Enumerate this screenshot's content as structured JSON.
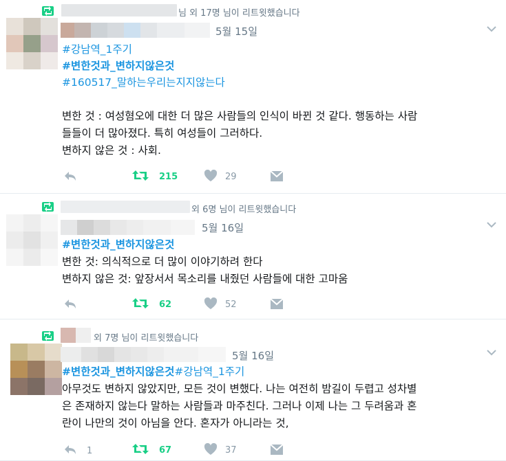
{
  "tweets": [
    {
      "retweeted_by": "님 외 17명 님이 리트윗했습니다",
      "date": "5월 15일",
      "hashtags": [
        "#강남역_1주기",
        "#변한것과_변하지않은것",
        "#160517_말하는우리는지지않는다"
      ],
      "body": [
        "변한 것 : 여성혐오에 대한 더 많은 사람들의 인식이 바뀐 것 같다. 행동하는 사람",
        "들들이 더 많아졌다. 특히 여성들이 그러하다.",
        "변하지 않은 것 : 사회."
      ],
      "retweets": "215",
      "likes": "29",
      "replies": ""
    },
    {
      "retweeted_by": "외 6명 님이 리트윗했습니다",
      "date": "5월 16일",
      "hashtags": [
        "#변한것과_변하지않은것"
      ],
      "body": [
        "변한 것: 의식적으로 더 많이 이야기하려 한다",
        "변하지 않은 것: 앞장서서 목소리를 내줬던 사람들에 대한 고마움"
      ],
      "retweets": "62",
      "likes": "52",
      "replies": ""
    },
    {
      "retweeted_by": "외 7명 님이 리트윗했습니다",
      "date": "5월 16일",
      "hashtags": [
        "#변한것과_변하지않은것",
        "#강남역_1주기"
      ],
      "body": [
        "아무것도 변하지 않았지만, 모든 것이 변했다. 나는 여전히 밤길이 두렵고 성차별",
        "은 존재하지 않는다 말하는 사람들과 마주친다. 그러나 이제 나는 그 두려움과 혼",
        "란이 나만의 것이 아님을 안다. 혼자가 아니라는 것,"
      ],
      "retweets": "67",
      "likes": "37",
      "replies": "1"
    }
  ],
  "icons": {
    "retweet_badge": "retweet-icon",
    "reply": "reply-icon",
    "retweet": "retweet-icon",
    "like": "heart-icon",
    "dm": "envelope-icon",
    "menu": "chevron-down-icon"
  },
  "colors": {
    "hashtag": "#1b95e0",
    "retweet_green": "#19cf86",
    "muted": "#657786",
    "icon_gray": "#aab8c2"
  }
}
